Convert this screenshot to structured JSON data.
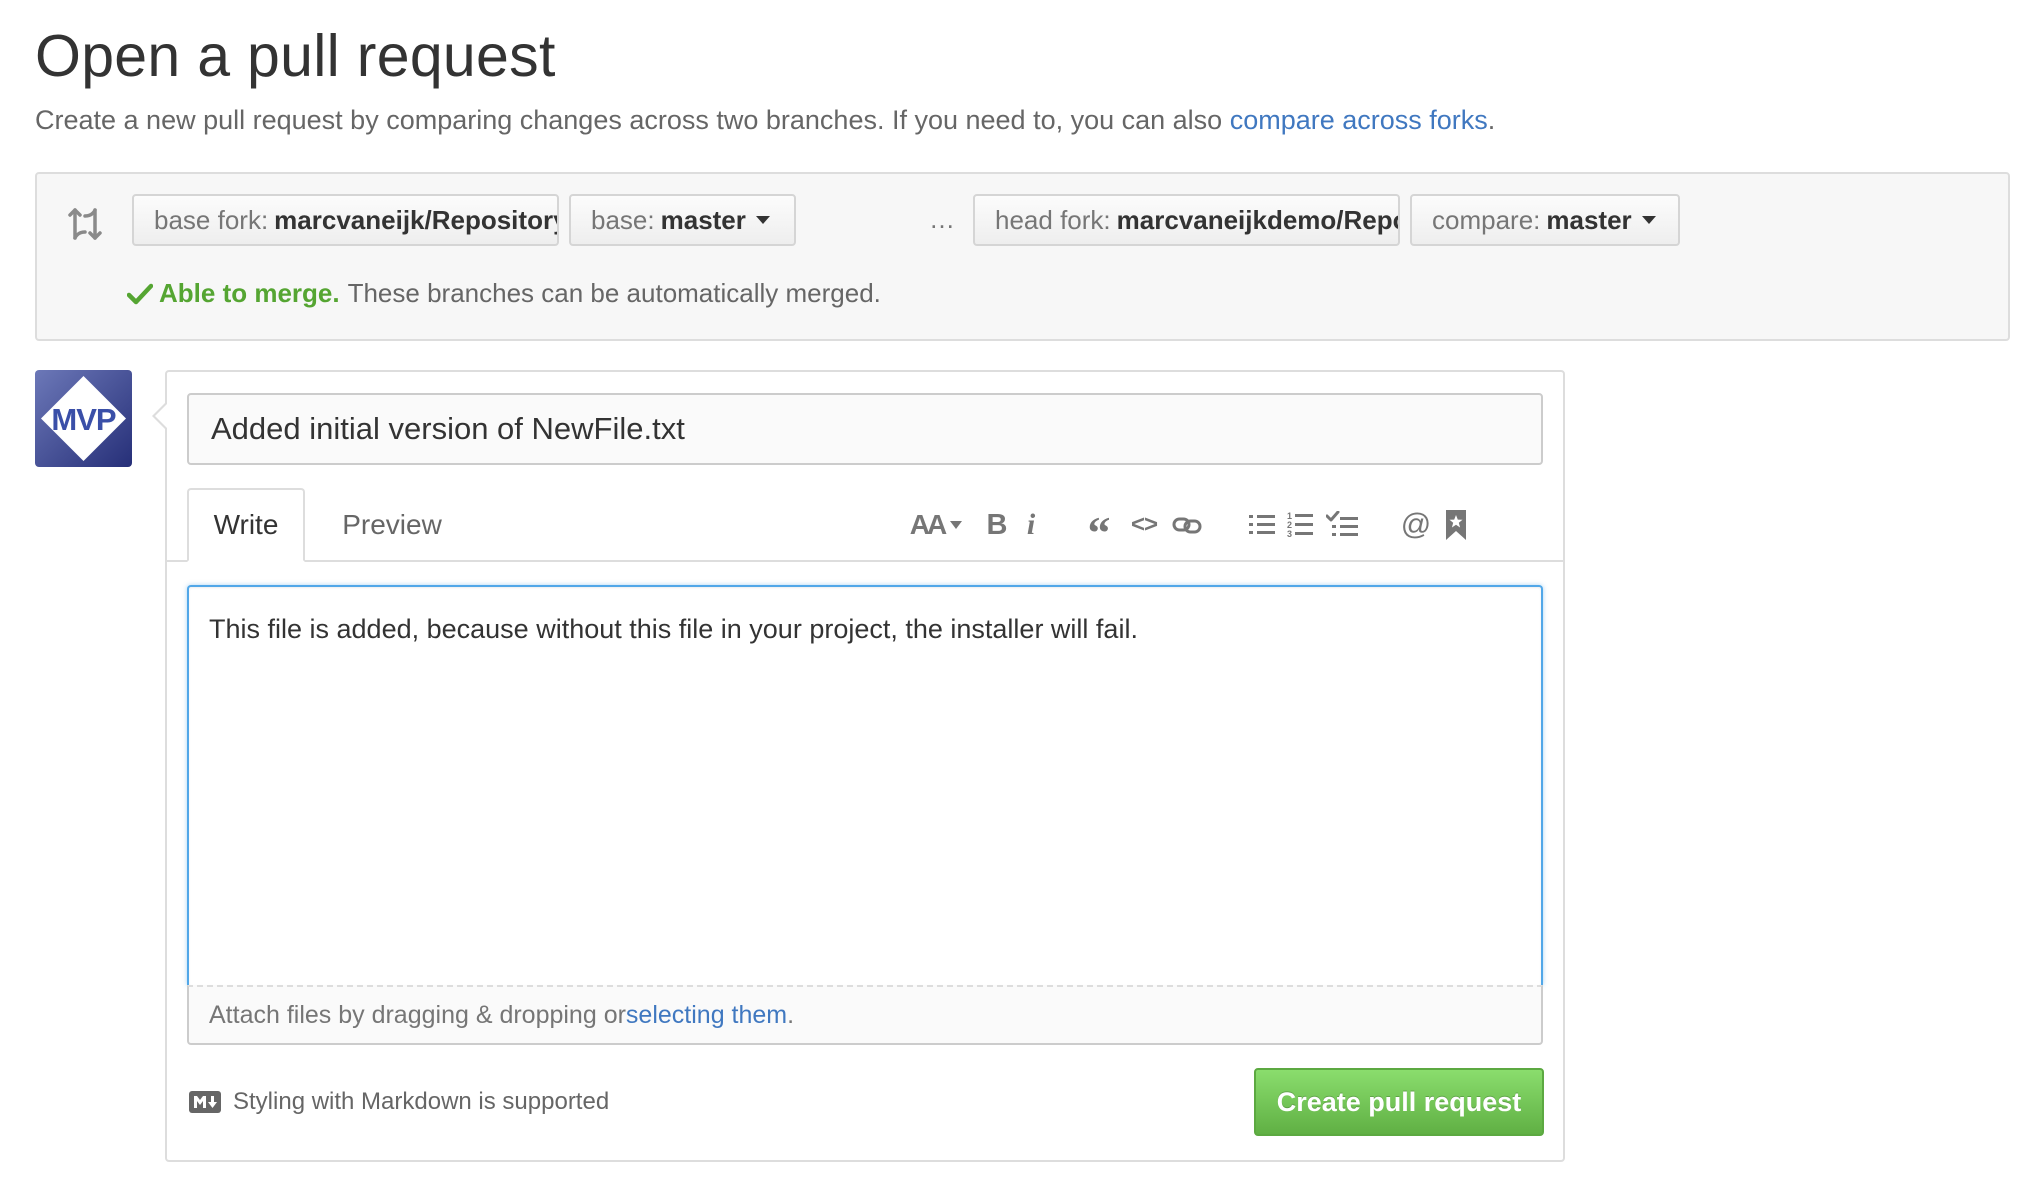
{
  "header": {
    "title": "Open a pull request",
    "description": "Create a new pull request by comparing changes across two branches. If you need to, you can also ",
    "compare_link": "compare across forks",
    "description_end": "."
  },
  "range": {
    "base_fork_label": "base fork:",
    "base_fork_value": "marcvaneijk/RepositoryIn…",
    "base_label": "base:",
    "base_value": "master",
    "separator": "…",
    "head_fork_label": "head fork:",
    "head_fork_value": "marcvaneijkdemo/Reposit…",
    "compare_label": "compare:",
    "compare_value": "master",
    "merge_ok": "Able to merge.",
    "merge_detail": "These branches can be automatically merged."
  },
  "avatar": {
    "text": "MVP"
  },
  "form": {
    "title_value": "Added initial version of NewFile.txt",
    "tab_write": "Write",
    "tab_preview": "Preview",
    "body_value": "This file is added, because without this file in your project, the installer will fail.",
    "attach_text": "Attach files by dragging & dropping or ",
    "attach_link": "selecting them",
    "attach_end": ".",
    "markdown_note": "Styling with Markdown is supported",
    "submit_label": "Create pull request"
  },
  "toolbar": {
    "heading": "AA",
    "bold": "B",
    "italic": "i",
    "quote": "“",
    "code": "<>",
    "mention": "@"
  },
  "colors": {
    "link": "#4078c0",
    "merge_ok": "#55a532",
    "button_green": "#60b044",
    "focus_blue": "#51a7e8"
  }
}
